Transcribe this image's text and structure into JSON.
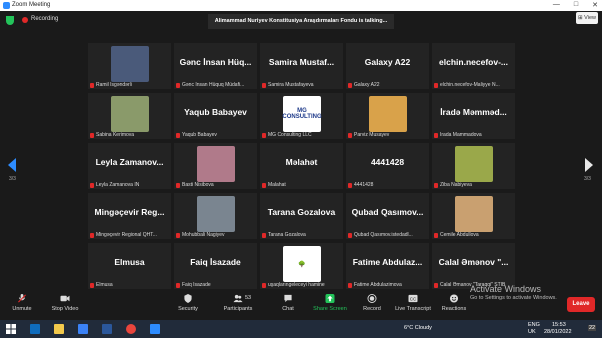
{
  "window": {
    "title": "Zoom Meeting",
    "controls": [
      "—",
      "□",
      "✕"
    ]
  },
  "meeting": {
    "recording_label": "Recording",
    "talking_banner": "Alimammad Nuriyev Konstitusiya Araşdırmaları Fondu is talking...",
    "view_label": "View",
    "page_left": "3/3",
    "page_right": "3/3"
  },
  "tiles": [
    {
      "big": "",
      "name": "Ramil İsgəndərli",
      "photo": true,
      "photo_color": "#4a5a7a"
    },
    {
      "big": "Gənc İnsan Hüq...",
      "name": "Gənc İnsan Hüquq Müdafi..."
    },
    {
      "big": "Samira Mustaf...",
      "name": "Samira Mustafayeva"
    },
    {
      "big": "Galaxy A22",
      "name": "Galaxy A22"
    },
    {
      "big": "elchin.necefov-...",
      "name": "elchin.necefov-Maliyye N..."
    },
    {
      "big": "",
      "name": "Sabina Kerimova",
      "photo": true,
      "photo_color": "#8a9a6a"
    },
    {
      "big": "Yaqub Babayev",
      "name": "Yaqub Babayev"
    },
    {
      "big": "",
      "name": "MG Consulting LLC",
      "photo": true,
      "photo_color": "#ffffff",
      "logo": "MG CONSULTING"
    },
    {
      "big": "",
      "name": "Parviz Musayev",
      "photo": true,
      "photo_color": "#d9a24a"
    },
    {
      "big": "İradə Məmməd...",
      "name": "İrada Mammadova"
    },
    {
      "big": "Leyla Zamanov...",
      "name": "Leyla Zamanova İN"
    },
    {
      "big": "",
      "name": "Basti Nisibova",
      "photo": true,
      "photo_color": "#b07a8a"
    },
    {
      "big": "Məlahət",
      "name": "Malahat"
    },
    {
      "big": "4441428",
      "name": "4441428"
    },
    {
      "big": "",
      "name": "Ziba Nabiyeva",
      "photo": true,
      "photo_color": "#9aa84a"
    },
    {
      "big": "Mingəçevir Reg...",
      "name": "Mingəçevir Regional QHT..."
    },
    {
      "big": "",
      "name": "Mohubbali Nagiyev",
      "photo": true,
      "photo_color": "#7a8590"
    },
    {
      "big": "Tarana Gozalova",
      "name": "Tarana Gozalova"
    },
    {
      "big": "Qubad Qasımov...",
      "name": "Qubad Qasımov.istedadl..."
    },
    {
      "big": "",
      "name": "Cemile Abdullova",
      "photo": true,
      "photo_color": "#c9a070"
    },
    {
      "big": "Elmusa",
      "name": "Elmusa"
    },
    {
      "big": "Faiq İsazade",
      "name": "Faiq İsazade"
    },
    {
      "big": "",
      "name": "uşaqlarıngeleceyi hamine",
      "photo": true,
      "photo_color": "#ffffff",
      "logo": "🌳"
    },
    {
      "big": "Fatime Abdulaz...",
      "name": "Fatime Abdulazimova"
    },
    {
      "big": "Calal Əmənov \"...",
      "name": "Calal Əmanov \"Taraqqi\" STIB"
    }
  ],
  "toolbar": {
    "unmute": "Unmute",
    "stop_video": "Stop Video",
    "security": "Security",
    "participants": "Participants",
    "participants_count": "53",
    "chat": "Chat",
    "share_screen": "Share Screen",
    "record": "Record",
    "live_transcript": "Live Transcript",
    "reactions": "Reactions",
    "leave": "Leave"
  },
  "watermark": {
    "line1": "Activate Windows",
    "line2": "Go to Settings to activate Windows."
  },
  "taskbar": {
    "weather": "6°C  Cloudy",
    "lang1": "ENG",
    "lang2": "UK",
    "time": "15:53",
    "date": "28/01/2022",
    "notif": "22"
  },
  "colors": {
    "accent": "#2d8cff",
    "leave": "#e02828",
    "share": "#23c35a"
  }
}
